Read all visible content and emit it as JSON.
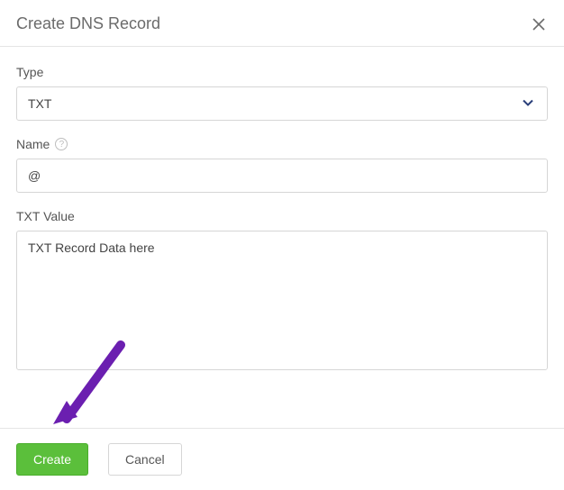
{
  "header": {
    "title": "Create DNS Record"
  },
  "fields": {
    "type": {
      "label": "Type",
      "value": "TXT"
    },
    "name": {
      "label": "Name",
      "value": "@"
    },
    "txtValue": {
      "label": "TXT Value",
      "value": "TXT Record Data here"
    }
  },
  "buttons": {
    "create": "Create",
    "cancel": "Cancel"
  },
  "colors": {
    "primary_button": "#5bbf3b",
    "annotation_arrow": "#6b1fb0"
  }
}
